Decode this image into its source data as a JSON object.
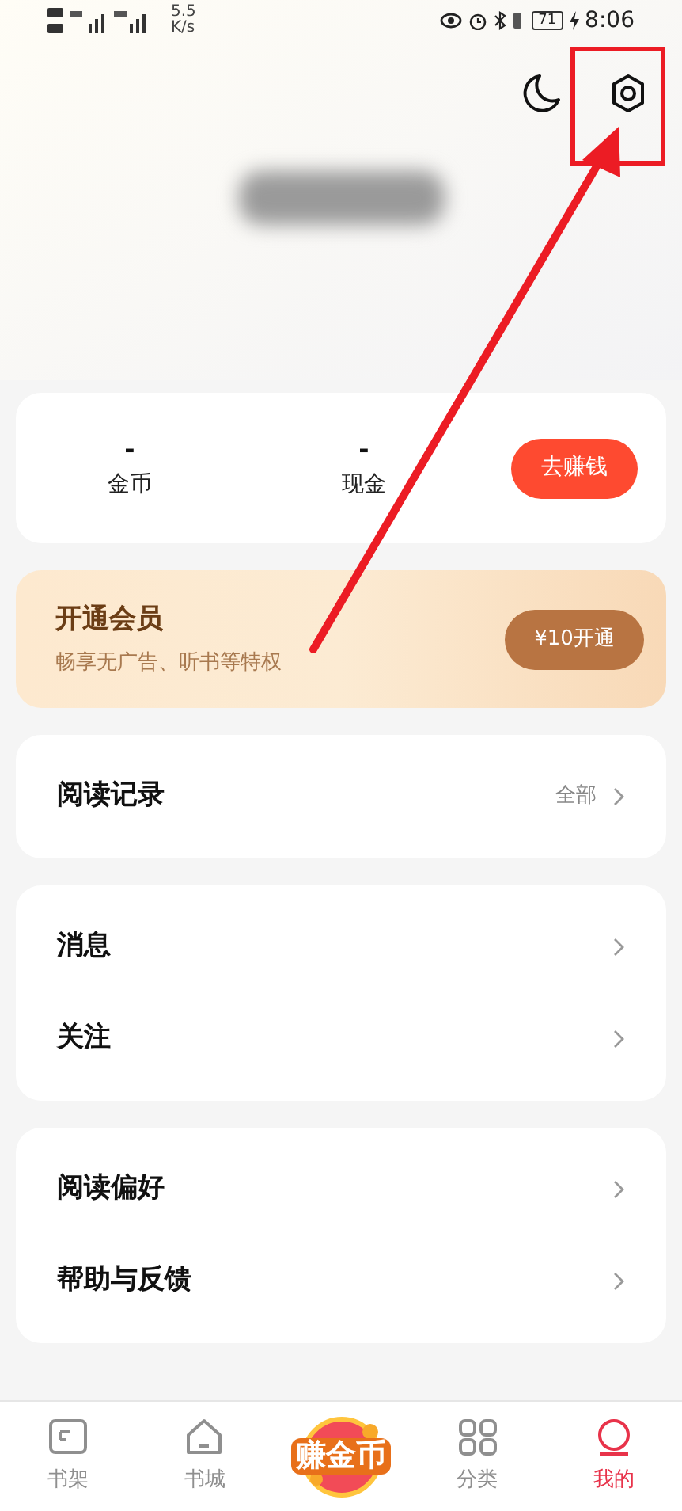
{
  "status_bar": {
    "speed_value": "5.5",
    "speed_unit": "K/s",
    "battery": "71",
    "time": "8:06"
  },
  "earn_card": {
    "stats": [
      {
        "value": "-",
        "label": "金币"
      },
      {
        "value": "-",
        "label": "现金"
      }
    ],
    "button": "去赚钱"
  },
  "vip_card": {
    "title": "开通会员",
    "subtitle": "畅享无广告、听书等特权",
    "button": "¥10开通"
  },
  "menu_groups": [
    [
      {
        "label": "阅读记录",
        "detail": "全部"
      }
    ],
    [
      {
        "label": "消息"
      },
      {
        "label": "关注"
      }
    ],
    [
      {
        "label": "阅读偏好"
      },
      {
        "label": "帮助与反馈"
      }
    ]
  ],
  "bottom_nav": [
    {
      "kind": "tab",
      "label": "书架",
      "selected": false
    },
    {
      "kind": "tab",
      "label": "书城",
      "selected": false
    },
    {
      "kind": "promo",
      "label": "赚金币"
    },
    {
      "kind": "tab",
      "label": "分类",
      "selected": false
    },
    {
      "kind": "tab",
      "label": "我的",
      "selected": true
    }
  ]
}
